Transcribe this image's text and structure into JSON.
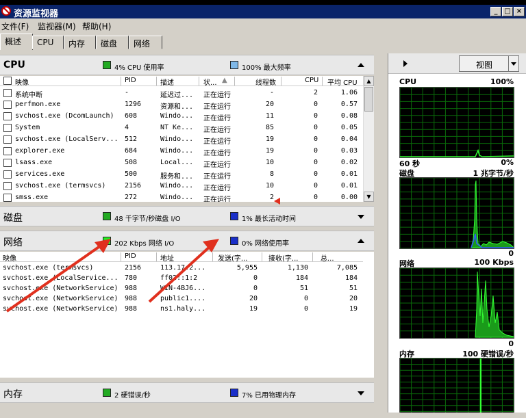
{
  "window": {
    "title": "资源监视器",
    "min": "_",
    "max": "□",
    "close": "×"
  },
  "menu": [
    "文件(F)",
    "监视器(M)",
    "帮助(H)"
  ],
  "tabs": [
    "概述",
    "CPU",
    "内存",
    "磁盘",
    "网络"
  ],
  "cpu": {
    "title": "CPU",
    "usage": {
      "text": "4% CPU 使用率",
      "color": "#22aa22"
    },
    "freq": {
      "text": "100% 最大频率",
      "color": "#7fb8e8"
    },
    "columns": [
      "映像",
      "PID",
      "描述",
      "状...",
      "线程数",
      "CPU",
      "平均 CPU"
    ],
    "rows": [
      [
        "系统中断",
        "-",
        "延迟过...",
        "正在运行",
        "-",
        "2",
        "1.06"
      ],
      [
        "perfmon.exe",
        "1296",
        "资源和...",
        "正在运行",
        "20",
        "0",
        "0.57"
      ],
      [
        "svchost.exe (DcomLaunch)",
        "608",
        "Windo...",
        "正在运行",
        "11",
        "0",
        "0.08"
      ],
      [
        "System",
        "4",
        "NT Ke...",
        "正在运行",
        "85",
        "0",
        "0.05"
      ],
      [
        "svchost.exe (LocalServ...",
        "512",
        "Windo...",
        "正在运行",
        "19",
        "0",
        "0.04"
      ],
      [
        "explorer.exe",
        "684",
        "Windo...",
        "正在运行",
        "19",
        "0",
        "0.03"
      ],
      [
        "lsass.exe",
        "508",
        "Local...",
        "正在运行",
        "10",
        "0",
        "0.02"
      ],
      [
        "services.exe",
        "500",
        "服务和...",
        "正在运行",
        "8",
        "0",
        "0.01"
      ],
      [
        "svchost.exe (termsvcs)",
        "2156",
        "Windo...",
        "正在运行",
        "10",
        "0",
        "0.01"
      ],
      [
        "smss.exe",
        "272",
        "Windo...",
        "正在运行",
        "2",
        "0",
        "0.00"
      ]
    ]
  },
  "disk": {
    "title": "磁盘",
    "io": {
      "text": "48 千字节/秒磁盘 I/O",
      "color": "#22aa22"
    },
    "active": {
      "text": "1% 最长活动时间",
      "color": "#1a2fc8"
    }
  },
  "network": {
    "title": "网络",
    "io": {
      "text": "202 Kbps 网络 I/O",
      "color": "#22ee22"
    },
    "usage": {
      "text": "0% 网络使用率",
      "color": "#1a2fc8"
    },
    "columns": [
      "映像",
      "PID",
      "地址",
      "发送(字...",
      "接收(字...",
      "总..."
    ],
    "rows": [
      [
        "svchost.exe (termsvcs)",
        "2156",
        "113.17.2...",
        "5,955",
        "1,130",
        "7,085"
      ],
      [
        "svchost.exe (LocalService...",
        "780",
        "ff02::1:2",
        "0",
        "184",
        "184"
      ],
      [
        "svchost.exe (NetworkService)",
        "988",
        "WIN-4BJ6...",
        "0",
        "51",
        "51"
      ],
      [
        "svchost.exe (NetworkService)",
        "988",
        "public1....",
        "20",
        "0",
        "20"
      ],
      [
        "svchost.exe (NetworkService)",
        "988",
        "ns1.haly...",
        "19",
        "0",
        "19"
      ]
    ]
  },
  "memory": {
    "title": "内存",
    "faults": {
      "text": "2 硬错误/秒",
      "color": "#22aa22"
    },
    "used": {
      "text": "7% 已用物理内存",
      "color": "#1a2fc8"
    }
  },
  "right": {
    "view_label": "视图",
    "cpu_graph": {
      "label": "CPU",
      "max": "100%",
      "time": "60 秒",
      "min": "0%"
    },
    "disk_graph": {
      "label": "磁盘",
      "max": "1 兆字节/秒",
      "min": "0"
    },
    "net_graph": {
      "label": "网络",
      "max": "100 Kbps",
      "min": "0"
    },
    "mem_graph": {
      "label": "内存",
      "max": "100 硬错误/秒"
    }
  }
}
